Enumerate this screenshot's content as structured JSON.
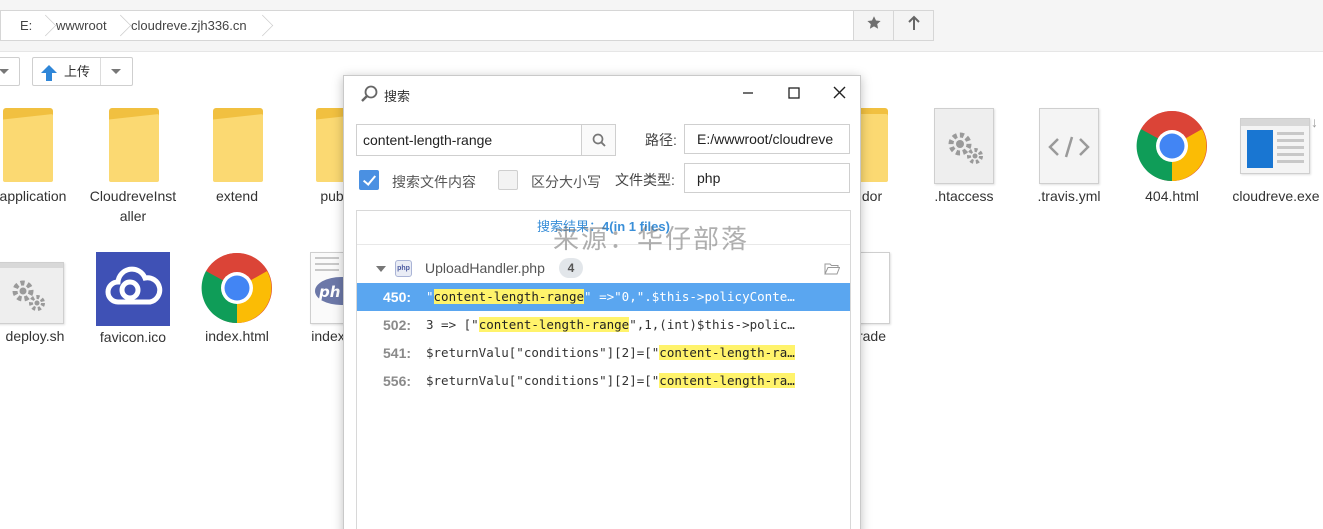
{
  "address": {
    "crumbs": [
      "E:",
      "wwwroot",
      "cloudreve.zjh336.cn"
    ]
  },
  "toolbar": {
    "upload_label": "上传"
  },
  "files": [
    {
      "name": "application",
      "kind": "folder"
    },
    {
      "name": "CloudreveInstaller",
      "kind": "folder",
      "line1": "CloudreveInst",
      "line2": "aller"
    },
    {
      "name": "extend",
      "kind": "folder"
    },
    {
      "name": "pub",
      "kind": "folder"
    },
    {
      "name": "dor",
      "kind": "folder"
    },
    {
      "name": ".htaccess",
      "kind": "gear-doc"
    },
    {
      "name": ".travis.yml",
      "kind": "code-doc"
    },
    {
      "name": "404.html",
      "kind": "chrome"
    },
    {
      "name": "cloudreve.exe",
      "kind": "exe"
    },
    {
      "name": "deploy.sh",
      "kind": "gear-doc"
    },
    {
      "name": "favicon.ico",
      "kind": "cloud"
    },
    {
      "name": "index.html",
      "kind": "chrome"
    },
    {
      "name": "index",
      "kind": "php"
    },
    {
      "name": "rade",
      "kind": "doc"
    }
  ],
  "dialog": {
    "title": "搜索",
    "keyword": "content-length-range",
    "path_label": "路径:",
    "path_value": "E:/wwwroot/cloudreve",
    "search_content_label": "搜索文件内容",
    "search_content_checked": true,
    "case_label": "区分大小写",
    "case_checked": false,
    "filetype_label": "文件类型:",
    "filetype_value": "php",
    "summary_prefix": "搜索结果：",
    "summary_count": "4",
    "summary_suffix": "(in 1 files)",
    "watermark": "来源：华仔部落",
    "group": {
      "file": "UploadHandler.php",
      "badge": "php",
      "count": "4"
    },
    "hits": [
      {
        "line": "450:",
        "pre": "\"",
        "match": "content-length-range",
        "post": "\" =>\"0,\".$this->policyConte…",
        "selected": true
      },
      {
        "line": "502:",
        "pre": "3 => [\"",
        "match": "content-length-range",
        "post": "\",1,(int)$this->polic…",
        "selected": false
      },
      {
        "line": "541:",
        "pre": "$returnValu[\"conditions\"][2]=[\"",
        "match": "content-length-ra…",
        "post": "",
        "selected": false
      },
      {
        "line": "556:",
        "pre": "$returnValu[\"conditions\"][2]=[\"",
        "match": "content-length-ra…",
        "post": "",
        "selected": false
      }
    ]
  },
  "colors": {
    "accent": "#4a90e2",
    "selection": "#5aa6f0",
    "highlight": "#fff36b",
    "folder": "#fbd972"
  }
}
